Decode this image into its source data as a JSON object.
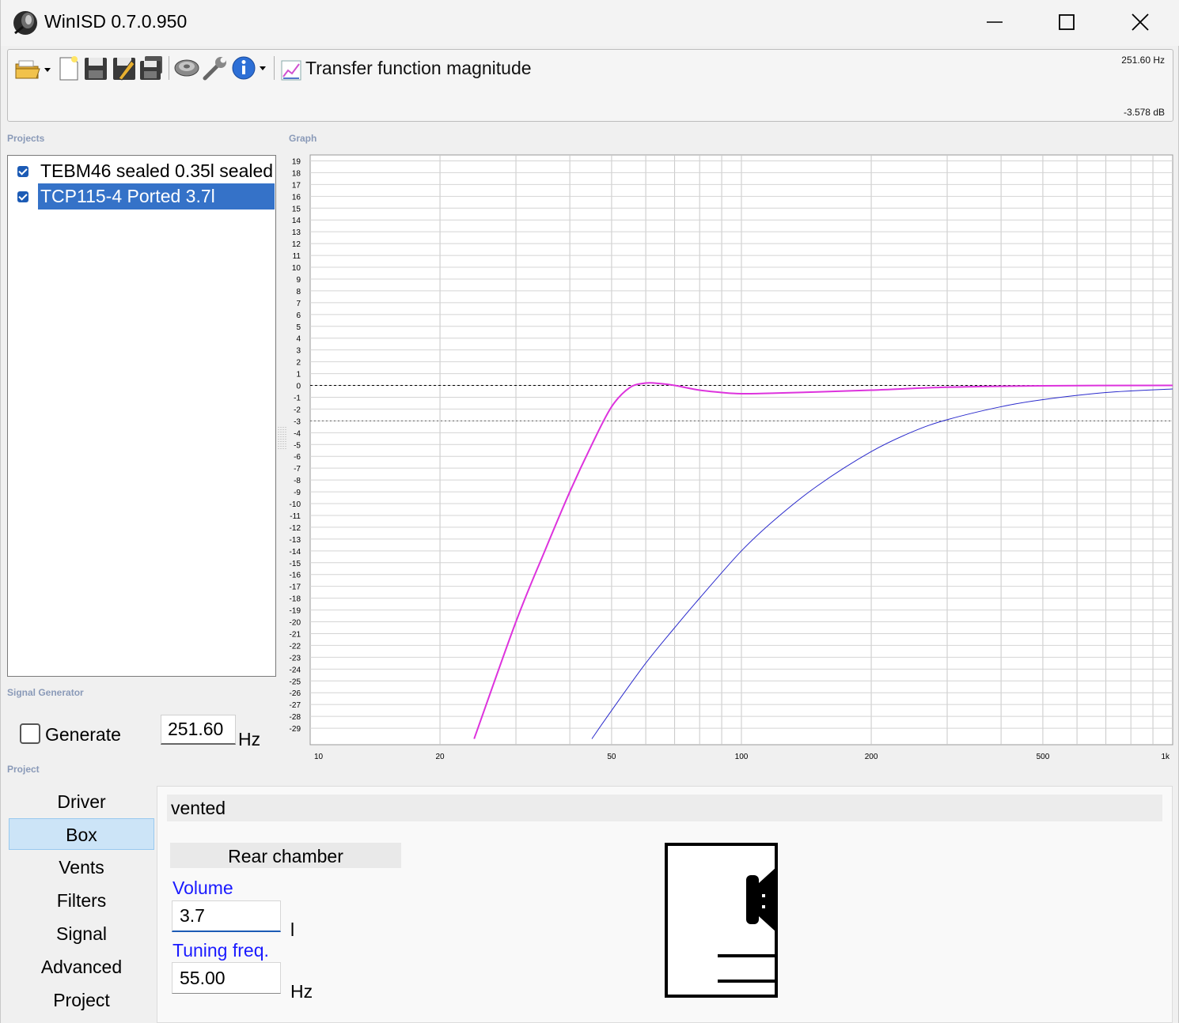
{
  "window": {
    "title": "WinISD 0.7.0.950"
  },
  "toolbar": {
    "icons": [
      "open-folder-icon",
      "new-file-icon",
      "save-icon",
      "save-as-icon",
      "save-all-icon",
      "speaker-driver-icon",
      "wrench-icon",
      "info-icon"
    ],
    "graph_title": "Transfer function magnitude",
    "freq_readout": "251.60 Hz",
    "db_readout": "-3.578 dB"
  },
  "sections": {
    "projects": "Projects",
    "graph": "Graph",
    "signal_generator": "Signal Generator",
    "project": "Project"
  },
  "projects": [
    {
      "name": "TEBM46 sealed 0.35l sealed",
      "checked": true,
      "selected": false
    },
    {
      "name": "TCP115-4 Ported 3.7l",
      "checked": true,
      "selected": true
    }
  ],
  "graph": {
    "y_ticks": [
      "19",
      "18",
      "17",
      "16",
      "15",
      "14",
      "13",
      "12",
      "11",
      "10",
      "9",
      "8",
      "7",
      "6",
      "5",
      "4",
      "3",
      "2",
      "1",
      "0",
      "-1",
      "-2",
      "-3",
      "-4",
      "-5",
      "-6",
      "-7",
      "-8",
      "-9",
      "-10",
      "-11",
      "-12",
      "-13",
      "-14",
      "-15",
      "-16",
      "-17",
      "-18",
      "-19",
      "-20",
      "-21",
      "-22",
      "-23",
      "-24",
      "-25",
      "-26",
      "-27",
      "-28",
      "-29"
    ],
    "x_ticks": [
      "10",
      "20",
      "50",
      "100",
      "200",
      "500",
      "1k"
    ]
  },
  "chart_data": {
    "type": "line",
    "title": "Transfer function magnitude",
    "xlabel": "",
    "ylabel": "",
    "x_scale": "log",
    "xlim": [
      10,
      1000
    ],
    "ylim": [
      -30,
      20
    ],
    "grid": true,
    "reference_lines": [
      0,
      -3
    ],
    "series": [
      {
        "color": "#dd33dd",
        "x": [
          24,
          30,
          35,
          40,
          45,
          50,
          55,
          60,
          65,
          70,
          80,
          90,
          100,
          120,
          150,
          200,
          300,
          500,
          1000
        ],
        "y": [
          -29.9,
          -20,
          -14,
          -9,
          -5,
          -1.8,
          -0.2,
          0.2,
          0.15,
          0,
          -0.4,
          -0.6,
          -0.7,
          -0.65,
          -0.55,
          -0.4,
          -0.15,
          -0.03,
          0
        ]
      },
      {
        "color": "#2a2acc",
        "x": [
          45,
          50,
          60,
          70,
          80,
          100,
          120,
          150,
          200,
          250,
          300,
          400,
          500,
          700,
          1000
        ],
        "y": [
          -29.9,
          -27.5,
          -23.5,
          -20.5,
          -18,
          -14,
          -11.3,
          -8.5,
          -5.6,
          -3.9,
          -2.9,
          -1.8,
          -1.2,
          -0.6,
          -0.3
        ]
      }
    ]
  },
  "signal_generator": {
    "generate_label": "Generate",
    "generate_checked": false,
    "freq_value": "251.60",
    "freq_unit": "Hz"
  },
  "project_nav": [
    {
      "label": "Driver",
      "active": false
    },
    {
      "label": "Box",
      "active": true
    },
    {
      "label": "Vents",
      "active": false
    },
    {
      "label": "Filters",
      "active": false
    },
    {
      "label": "Signal",
      "active": false
    },
    {
      "label": "Advanced",
      "active": false
    },
    {
      "label": "Project",
      "active": false
    }
  ],
  "box": {
    "type": "vented",
    "chamber_header": "Rear chamber",
    "volume_label": "Volume",
    "volume_value": "3.7",
    "volume_unit": "l",
    "tuning_label": "Tuning freq.",
    "tuning_value": "55.00",
    "tuning_unit": "Hz"
  }
}
